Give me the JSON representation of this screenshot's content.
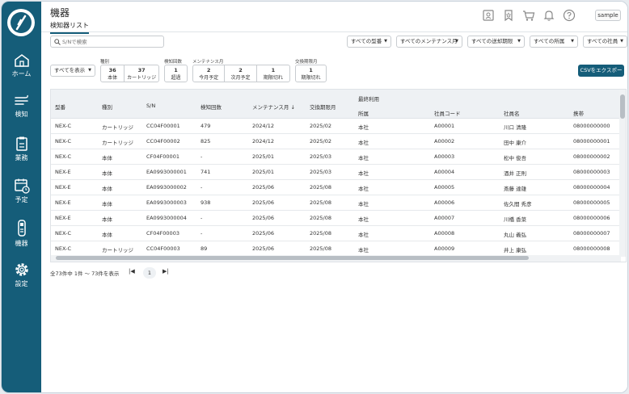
{
  "sidebar": {
    "items": [
      {
        "label": "ホーム",
        "icon": "home-icon"
      },
      {
        "label": "検知",
        "icon": "detection-icon"
      },
      {
        "label": "業務",
        "icon": "clipboard-icon"
      },
      {
        "label": "予定",
        "icon": "calendar-icon"
      },
      {
        "label": "機器",
        "icon": "device-icon"
      },
      {
        "label": "設定",
        "icon": "gear-icon"
      }
    ]
  },
  "header": {
    "title": "機器",
    "subtab": "検知器リスト",
    "user": "sample"
  },
  "search": {
    "placeholder": "S/Nで検索"
  },
  "filters": [
    "すべての型番",
    "すべてのメンテナンス月",
    "すべての送却期限",
    "すべての所属",
    "すべての社員"
  ],
  "show_select": "すべてを表示",
  "groups": {
    "type": {
      "label": "種別",
      "cells": [
        {
          "count": "36",
          "label": "本体"
        },
        {
          "count": "37",
          "label": "カートリッジ"
        }
      ]
    },
    "detect": {
      "label": "検知回数",
      "cells": [
        {
          "count": "1",
          "label": "超過"
        }
      ]
    },
    "maint": {
      "label": "メンテナンス月",
      "cells": [
        {
          "count": "2",
          "label": "今月予定"
        },
        {
          "count": "2",
          "label": "次月予定"
        },
        {
          "count": "1",
          "label": "期限切れ"
        }
      ]
    },
    "exchange": {
      "label": "交換期限月",
      "cells": [
        {
          "count": "1",
          "label": "期限切れ"
        }
      ]
    }
  },
  "csv_button": "CSVをエクスポート",
  "table": {
    "group_header": "最終利用",
    "columns": [
      "型番",
      "種別",
      "S/N",
      "検知回数",
      "メンテナンス月",
      "交換期限月",
      "所属",
      "社員コード",
      "社員名",
      "携帯"
    ],
    "sort_arrow": "↓",
    "rows": [
      [
        "NEX-C",
        "カートリッジ",
        "CC04F00001",
        "479",
        "2024/12",
        "2025/02",
        "本社",
        "A00001",
        "川口 清隆",
        "08000000000"
      ],
      [
        "NEX-C",
        "カートリッジ",
        "CC04F00002",
        "825",
        "2024/12",
        "2025/02",
        "本社",
        "A00002",
        "田中 康介",
        "08000000001"
      ],
      [
        "NEX-C",
        "本体",
        "CF04F00001",
        "-",
        "2025/01",
        "2025/03",
        "本社",
        "A00003",
        "松中 俊吾",
        "08000000002"
      ],
      [
        "NEX-E",
        "本体",
        "EA0993000001",
        "741",
        "2025/01",
        "2025/03",
        "本社",
        "A00004",
        "酒井 正則",
        "08000000003"
      ],
      [
        "NEX-E",
        "本体",
        "EA0993000002",
        "-",
        "2025/06",
        "2025/08",
        "本社",
        "A00005",
        "斎藤 達雄",
        "08000000004"
      ],
      [
        "NEX-E",
        "本体",
        "EA0993000003",
        "938",
        "2025/06",
        "2025/08",
        "本社",
        "A00006",
        "佐久間 秀彦",
        "08000000005"
      ],
      [
        "NEX-E",
        "本体",
        "EA0993000004",
        "-",
        "2025/06",
        "2025/08",
        "本社",
        "A00007",
        "川橋 香菜",
        "08000000006"
      ],
      [
        "NEX-C",
        "本体",
        "CF04F00003",
        "-",
        "2025/06",
        "2025/08",
        "本社",
        "A00008",
        "丸山 義弘",
        "08000000007"
      ],
      [
        "NEX-C",
        "カートリッジ",
        "CC04F00003",
        "89",
        "2025/06",
        "2025/08",
        "本社",
        "A00009",
        "井上 康弘",
        "08000000008"
      ]
    ]
  },
  "pager": {
    "summary": "全73件中 1件 〜 73件を表示",
    "first": "|◀",
    "page": "1",
    "last": "▶|"
  }
}
